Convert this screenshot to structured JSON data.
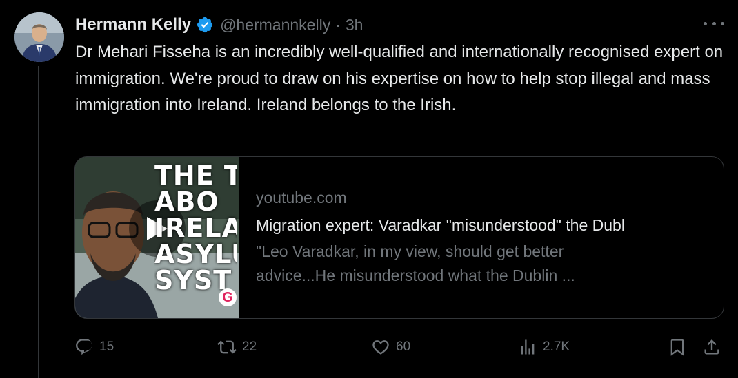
{
  "author": {
    "display_name": "Hermann Kelly",
    "handle": "@hermannkelly",
    "separator": "·",
    "time": "3h",
    "verified_color": "#1d9bf0"
  },
  "text": "Dr Mehari Fisseha is an incredibly well-qualified and internationally recognised expert on immigration. We're proud to draw on his expertise on how to help stop illegal and mass immigration into Ireland. Ireland belongs to the Irish.",
  "card": {
    "thumbnail_caption": "THE TR\nABO\nIRELAN\nASYLU\nSYST",
    "thumbnail_badge": "G",
    "domain": "youtube.com",
    "title": "Migration expert: Varadkar \"misunderstood\" the Dubl",
    "description": "\"Leo Varadkar, in my view, should get better advice...He misunderstood what the Dublin ..."
  },
  "actions": {
    "replies": "15",
    "reposts": "22",
    "likes": "60",
    "views": "2.7K"
  },
  "icons": [
    "more-icon",
    "verified-icon",
    "play-icon",
    "reply-icon",
    "repost-icon",
    "like-icon",
    "views-icon",
    "bookmark-icon",
    "share-icon"
  ],
  "colors": {
    "background": "#000000",
    "text": "#e7e9ea",
    "muted": "#71767b",
    "border": "#333639",
    "accent": "#1d9bf0"
  }
}
